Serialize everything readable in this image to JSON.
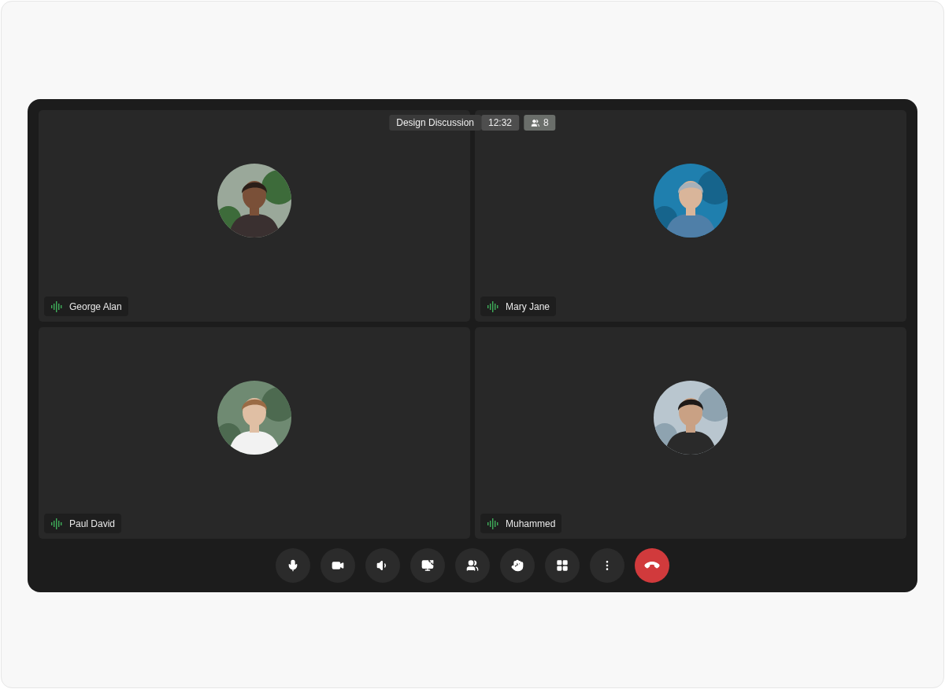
{
  "meeting": {
    "title": "Design Discussion",
    "time": "12:32",
    "participant_count": "8"
  },
  "participants": [
    {
      "name": "George Alan",
      "speaking": true
    },
    {
      "name": "Mary Jane",
      "speaking": true
    },
    {
      "name": "Paul David",
      "speaking": true
    },
    {
      "name": "Muhammed",
      "speaking": true
    }
  ],
  "controls": [
    {
      "kind": "mic"
    },
    {
      "kind": "camera"
    },
    {
      "kind": "speaker"
    },
    {
      "kind": "share"
    },
    {
      "kind": "people"
    },
    {
      "kind": "hand"
    },
    {
      "kind": "layout"
    },
    {
      "kind": "more"
    },
    {
      "kind": "end-call"
    }
  ]
}
